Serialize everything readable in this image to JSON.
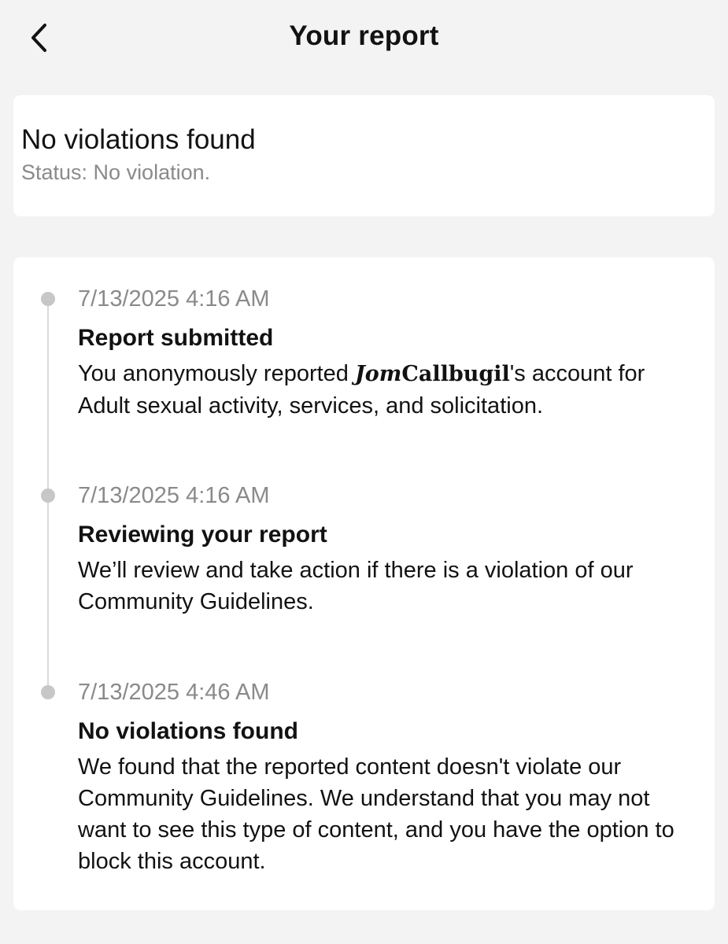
{
  "header": {
    "title": "Your report",
    "back_icon": "chevron-left-icon"
  },
  "status": {
    "title": "No violations found",
    "subtitle": "Status: No violation."
  },
  "timeline": [
    {
      "date": "7/13/2025 4:16 AM",
      "title": "Report submitted",
      "body_prefix": "You anonymously reported ",
      "username_initials": "Jom",
      "username_rest": "Callbugil",
      "body_suffix": "'s account for Adult sexual activity, services, and solicitation."
    },
    {
      "date": "7/13/2025 4:16 AM",
      "title": "Reviewing your report",
      "body": "We’ll review and take action if there is a violation of our Community Guidelines."
    },
    {
      "date": "7/13/2025 4:46 AM",
      "title": "No violations found",
      "body": "We found that the reported content doesn't violate our Community Guidelines. We understand that you may not want to see this type of content, and you have the option to block this account."
    }
  ],
  "colors": {
    "background": "#f3f3f3",
    "card": "#ffffff",
    "primary_text": "#121212",
    "secondary_text": "#8a8a8a",
    "timeline": "#c7c7c7"
  }
}
